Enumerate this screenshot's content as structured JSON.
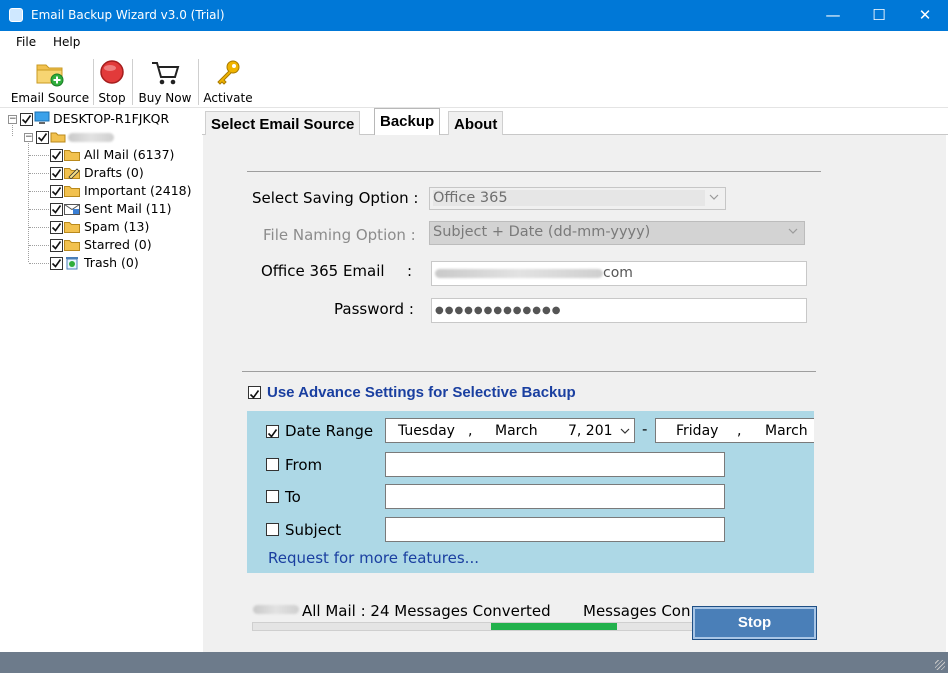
{
  "window": {
    "title": "Email Backup Wizard v3.0 (Trial)",
    "controls": {
      "minimize": "—",
      "maximize": "☐",
      "close": "✕"
    }
  },
  "menu": {
    "items": [
      "File",
      "Help"
    ]
  },
  "toolbar": {
    "email_source": "Email Source",
    "stop": "Stop",
    "buy_now": "Buy Now",
    "activate": "Activate"
  },
  "tree": {
    "root": "DESKTOP-R1FJKQR",
    "folders": [
      {
        "label": "All Mail (6137)",
        "icon": "folder-icon"
      },
      {
        "label": "Drafts (0)",
        "icon": "drafts-folder-icon"
      },
      {
        "label": "Important (2418)",
        "icon": "folder-icon"
      },
      {
        "label": "Sent Mail (11)",
        "icon": "sent-mail-icon"
      },
      {
        "label": "Spam (13)",
        "icon": "folder-icon"
      },
      {
        "label": "Starred (0)",
        "icon": "folder-icon"
      },
      {
        "label": "Trash (0)",
        "icon": "trash-icon"
      }
    ]
  },
  "tabs": [
    "Select Email Source",
    "Backup",
    "About"
  ],
  "active_tab": "Backup",
  "backup": {
    "saving_option_label": "Select Saving Option :",
    "saving_option_value": "Office 365",
    "naming_option_label": "File Naming Option :",
    "naming_option_value": "Subject + Date (dd-mm-yyyy)",
    "email_label": "Office 365 Email",
    "email_colon": ":",
    "email_value_suffix": "com",
    "password_label": "Password :",
    "password_value": "●●●●●●●●●●●●●"
  },
  "advanced": {
    "toggle_label": "Use Advance Settings for Selective Backup",
    "toggle_checked": true,
    "date_range_label": "Date Range",
    "date_range_checked": true,
    "start_date": {
      "weekday": "Tuesday",
      "sep": ",",
      "month": "March",
      "daynum": "7, 201"
    },
    "dash": "-",
    "end_date": {
      "weekday": "Friday",
      "sep": ",",
      "month": "March"
    },
    "from_label": "From",
    "to_label": "To",
    "subject_label": "Subject",
    "request_link": "Request for more features..."
  },
  "progress": {
    "folder_status": "All Mail : 24 Messages Converted",
    "messages_status": "Messages Con",
    "fill_start_fraction": 0.424,
    "fill_end_fraction": 0.647
  },
  "stop_button": "Stop",
  "colors": {
    "titlebar": "#0078d7",
    "panel": "#f0f0f0",
    "advanced_bg": "#add8e6",
    "link": "#1a3fa0",
    "progress_fill": "#22b14c",
    "stop_button": "#4a7fb8",
    "statusbar": "#6d7b8b"
  }
}
